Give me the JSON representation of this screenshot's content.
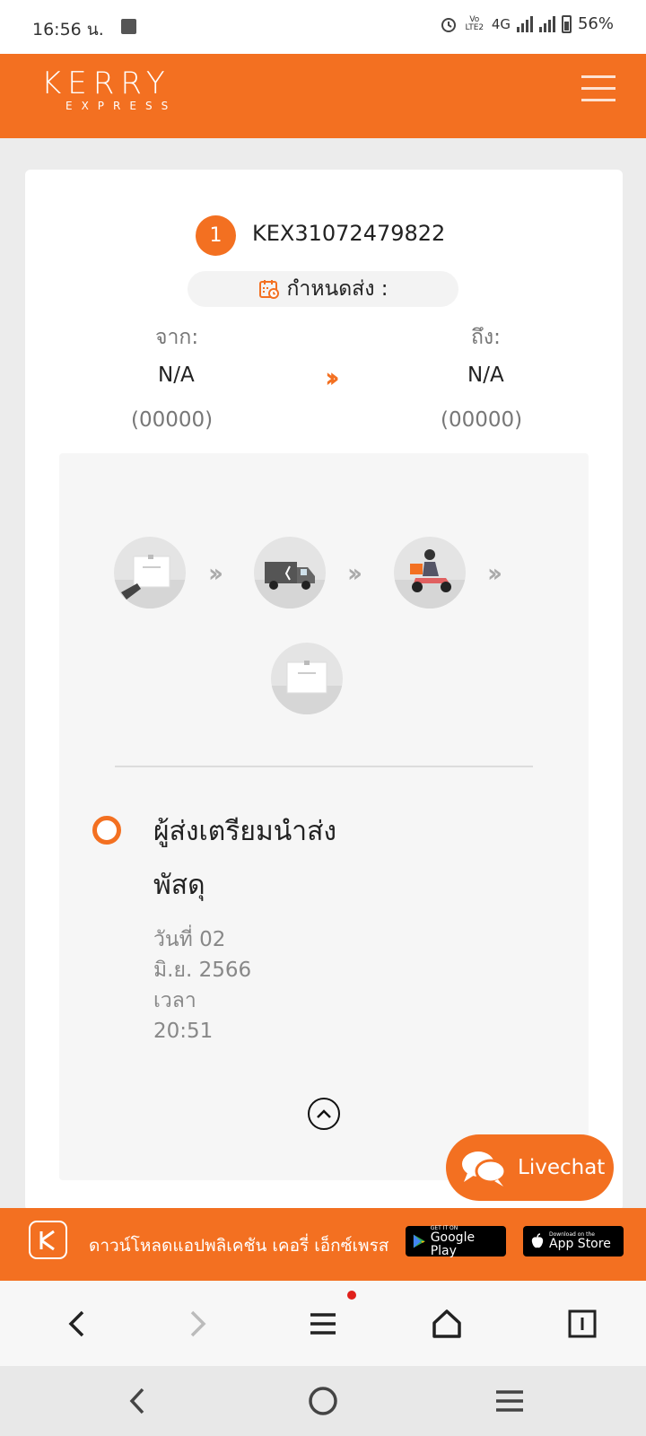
{
  "status_bar": {
    "time": "16:56 น.",
    "network": "4G",
    "battery": "56%",
    "lte_label": "Vo LTE2"
  },
  "header": {
    "logo_main": "KERRY",
    "logo_sub": "EXPRESS",
    "menu_icon": "hamburger-icon"
  },
  "shipment": {
    "index": "1",
    "tracking_number": "KEX31072479822",
    "due_label": "กำหนดส่ง :",
    "from_label": "จาก:",
    "to_label": "ถึง:",
    "from_value": "N/A",
    "to_value": "N/A",
    "from_code": "(00000)",
    "to_code": "(00000)",
    "direction_icon": "double-chevron-right-icon"
  },
  "progress_steps": [
    {
      "icon": "parcel-handover-icon",
      "state": "active"
    },
    {
      "icon": "delivery-truck-icon",
      "state": "inactive"
    },
    {
      "icon": "courier-scooter-icon",
      "state": "inactive"
    },
    {
      "icon": "delivered-parcel-icon",
      "state": "inactive"
    }
  ],
  "status": {
    "title": "ผู้ส่งเตรียมนำส่งพัสดุ",
    "date_line1": "วันที่ 02",
    "date_line2": "มิ.ย. 2566",
    "time_label": "เวลา",
    "time_value": "20:51"
  },
  "livechat": {
    "label": "Livechat"
  },
  "app_banner": {
    "text": "ดาวน์โหลดแอปพลิเคชัน เคอรี่ เอ็กซ์เพรส",
    "google_play_small": "GET IT ON",
    "google_play_big": "Google Play",
    "app_store_small": "Download on the",
    "app_store_big": "App Store"
  },
  "colors": {
    "brand": "#f37021",
    "panel": "#f6f6f6",
    "muted_text": "#777777"
  }
}
